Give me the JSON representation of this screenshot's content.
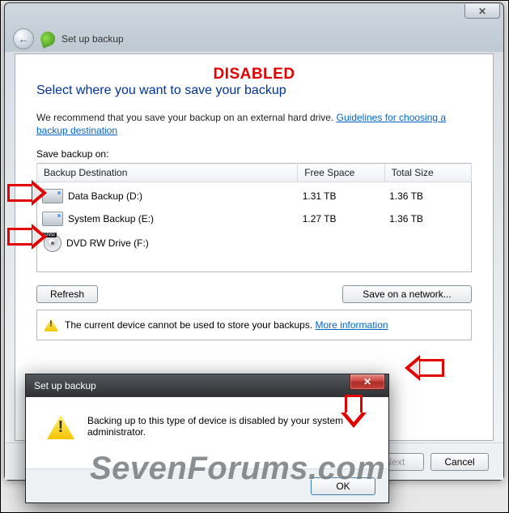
{
  "window": {
    "breadcrumb": "Set up backup",
    "close_x": "✕"
  },
  "annotation": {
    "disabled_stamp": "DISABLED",
    "watermark": "SevenForums.com"
  },
  "main": {
    "heading": "Select where you want to save your backup",
    "recommend_prefix": "We recommend that you save your backup on an external hard drive. ",
    "guidelines_link": "Guidelines for choosing a backup destination",
    "save_on_label": "Save backup on:",
    "columns": {
      "dest": "Backup Destination",
      "free": "Free Space",
      "total": "Total Size"
    },
    "rows": [
      {
        "name": "Data Backup (D:)",
        "free": "1.31 TB",
        "total": "1.36 TB",
        "icon": "hdd"
      },
      {
        "name": "System Backup (E:)",
        "free": "1.27 TB",
        "total": "1.36 TB",
        "icon": "hdd"
      },
      {
        "name": "DVD RW Drive (F:)",
        "free": "",
        "total": "",
        "icon": "dvd"
      }
    ],
    "refresh_label": "Refresh",
    "network_label": "Save on a network...",
    "warn_text": "The current device cannot be used to store your backups. ",
    "more_info_link": "More information"
  },
  "footer": {
    "next_label": "Next",
    "cancel_label": "Cancel"
  },
  "modal": {
    "title": "Set up backup",
    "close_x": "✕",
    "message": "Backing up to this type of device is disabled by your system administrator.",
    "ok_label": "OK"
  }
}
